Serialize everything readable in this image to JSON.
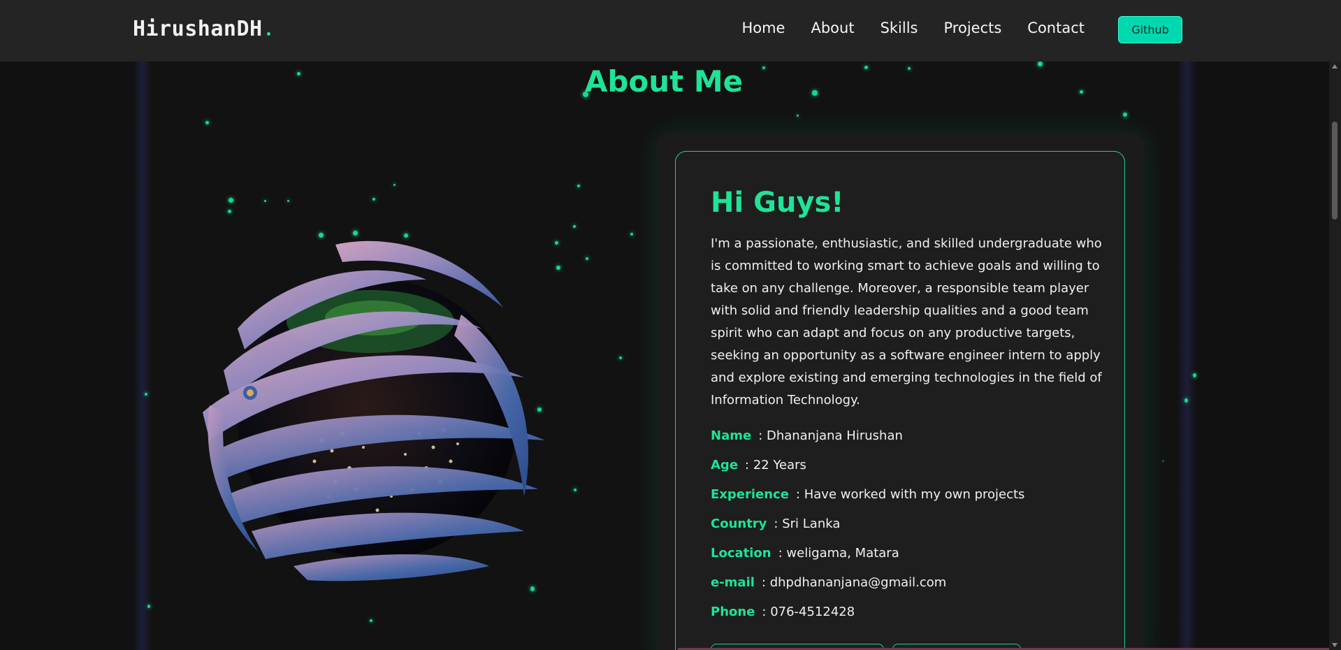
{
  "nav": {
    "brand": "HirushanDH",
    "links": [
      "Home",
      "About",
      "Skills",
      "Projects",
      "Contact"
    ],
    "github_label": "Github"
  },
  "about": {
    "title": "About Me",
    "greeting": "Hi Guys!",
    "bio": "I'm a passionate, enthusiastic, and skilled undergraduate who is committed to working smart to achieve goals and willing to take on any challenge. Moreover, a responsible team player with solid and friendly leadership qualities and a good team spirit who can adapt and focus on any productive targets, seeking an opportunity as a software engineer intern to apply and explore existing and emerging technologies in the field of Information Technology.",
    "info": [
      {
        "label": "Name",
        "value": ": Dhananjana Hirushan"
      },
      {
        "label": "Age",
        "value": ": 22 Years"
      },
      {
        "label": "Experience",
        "value": ": Have worked with my own projects"
      },
      {
        "label": "Country",
        "value": ": Sri Lanka"
      },
      {
        "label": "Location",
        "value": ": weligama, Matara"
      },
      {
        "label": "e-mail",
        "value": ": dhpdhananjana@gmail.com"
      },
      {
        "label": "Phone",
        "value": ": 076-4512428"
      }
    ]
  },
  "colors": {
    "accent": "#1fe397",
    "navbar_bg": "#242424",
    "page_bg": "#111111",
    "github_bg": "#00d8b0"
  },
  "icons": {
    "globe": "planet-globe-3d"
  }
}
